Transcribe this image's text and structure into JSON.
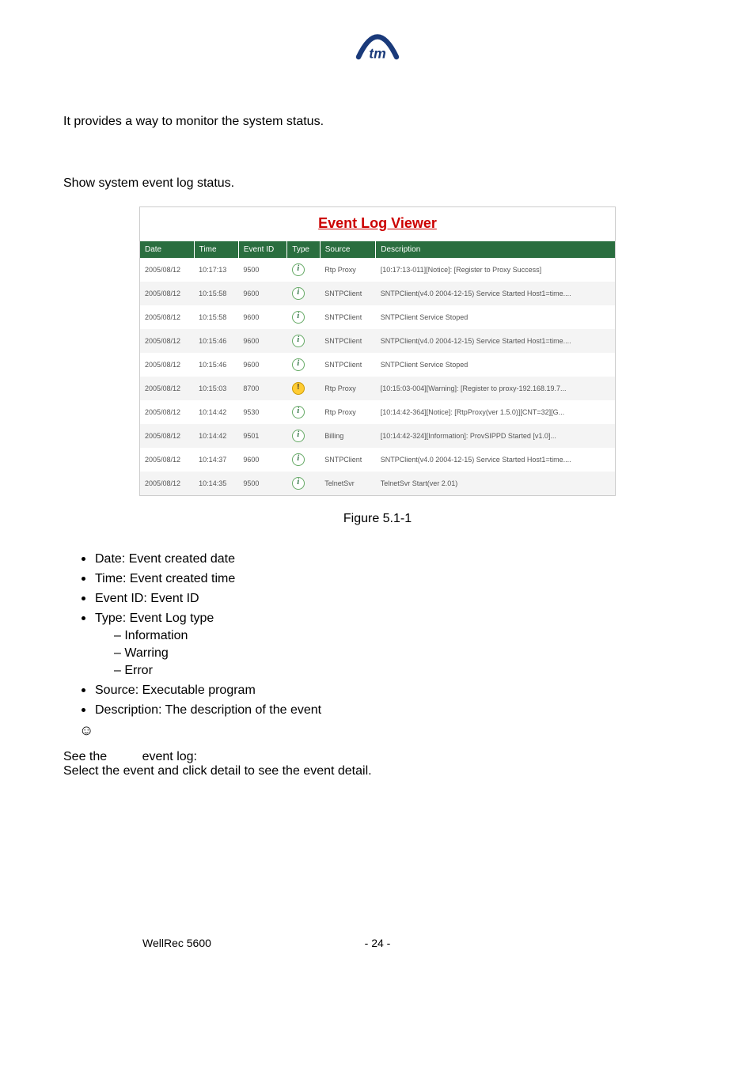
{
  "intro": "It provides a way to monitor the system status.",
  "sub": "Show system event log status.",
  "viewer_title": "Event Log Viewer",
  "columns": {
    "date": "Date",
    "time": "Time",
    "event_id": "Event ID",
    "type": "Type",
    "source": "Source",
    "desc": "Description"
  },
  "rows": [
    {
      "date": "2005/08/12",
      "time": "10:17:13",
      "id": "9500",
      "icon": "info",
      "source": "Rtp Proxy",
      "desc": "[10:17:13-011][Notice]: [Register to Proxy Success]"
    },
    {
      "date": "2005/08/12",
      "time": "10:15:58",
      "id": "9600",
      "icon": "info",
      "source": "SNTPClient",
      "desc": "SNTPClient(v4.0 2004-12-15) Service Started Host1=time...."
    },
    {
      "date": "2005/08/12",
      "time": "10:15:58",
      "id": "9600",
      "icon": "info",
      "source": "SNTPClient",
      "desc": "SNTPClient Service Stoped"
    },
    {
      "date": "2005/08/12",
      "time": "10:15:46",
      "id": "9600",
      "icon": "info",
      "source": "SNTPClient",
      "desc": "SNTPClient(v4.0 2004-12-15) Service Started Host1=time...."
    },
    {
      "date": "2005/08/12",
      "time": "10:15:46",
      "id": "9600",
      "icon": "info",
      "source": "SNTPClient",
      "desc": "SNTPClient Service Stoped"
    },
    {
      "date": "2005/08/12",
      "time": "10:15:03",
      "id": "8700",
      "icon": "warn",
      "source": "Rtp Proxy",
      "desc": "[10:15:03-004][Warning]: [Register to proxy-192.168.19.7..."
    },
    {
      "date": "2005/08/12",
      "time": "10:14:42",
      "id": "9530",
      "icon": "info",
      "source": "Rtp Proxy",
      "desc": "[10:14:42-364][Notice]: [RtpProxy(ver 1.5.0)][CNT=32][G..."
    },
    {
      "date": "2005/08/12",
      "time": "10:14:42",
      "id": "9501",
      "icon": "info",
      "source": "Billing",
      "desc": "[10:14:42-324][Information]: ProvSIPPD Started [v1.0]..."
    },
    {
      "date": "2005/08/12",
      "time": "10:14:37",
      "id": "9600",
      "icon": "info",
      "source": "SNTPClient",
      "desc": "SNTPClient(v4.0 2004-12-15) Service Started Host1=time...."
    },
    {
      "date": "2005/08/12",
      "time": "10:14:35",
      "id": "9500",
      "icon": "info",
      "source": "TelnetSvr",
      "desc": "TelnetSvr Start(ver 2.01)"
    }
  ],
  "fig_caption": "Figure 5.1-1",
  "bullets": {
    "date": "Date: Event created date",
    "time": "Time: Event created time",
    "event_id": "Event ID: Event ID",
    "type": "Type: Event Log type",
    "sub": {
      "info": "Information",
      "warn": "Warring",
      "err": "Error"
    },
    "source": "Source: Executable program",
    "desc": "Description: The description of the event"
  },
  "smiley": "☺",
  "see": {
    "a": "See the",
    "b": "event log:",
    "c": "Select the event and click detail to see the event detail."
  },
  "footer": {
    "product": "WellRec 5600",
    "page": "- 24 -"
  }
}
